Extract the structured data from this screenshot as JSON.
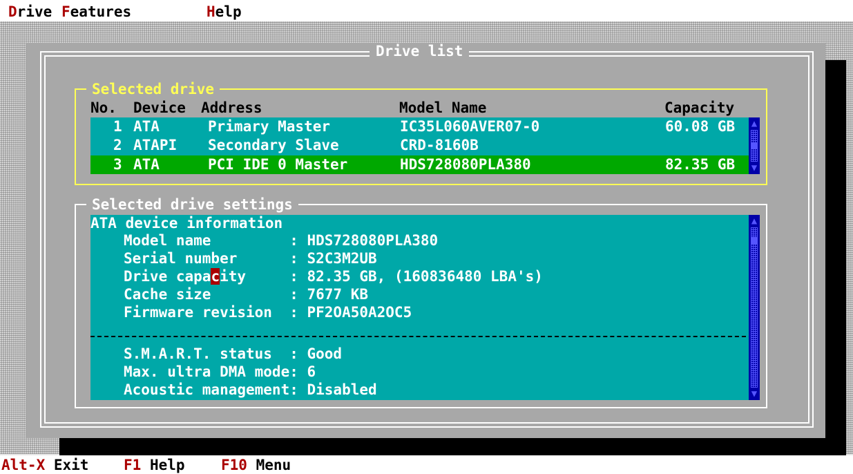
{
  "menu": {
    "items": [
      {
        "hotkey": "D",
        "rest": "rive"
      },
      {
        "hotkey": "F",
        "rest": "eatures"
      },
      {
        "hotkey": "H",
        "rest": "elp"
      }
    ]
  },
  "window": {
    "title": "Drive list"
  },
  "selected_drive": {
    "title": "Selected drive",
    "columns": {
      "no": "No.",
      "device": "Device",
      "address": "Address",
      "model": "Model Name",
      "capacity": "Capacity"
    },
    "rows": [
      {
        "no": "1",
        "device": "ATA",
        "address": "Primary Master",
        "model": "IC35L060AVER07-0",
        "capacity": "60.08 GB",
        "selected": false
      },
      {
        "no": "2",
        "device": "ATAPI",
        "address": "Secondary Slave",
        "model": "CRD-8160B",
        "capacity": "",
        "selected": false
      },
      {
        "no": "3",
        "device": "ATA",
        "address": "PCI IDE 0 Master",
        "model": "HDS728080PLA380",
        "capacity": "82.35 GB",
        "selected": true
      }
    ]
  },
  "settings": {
    "title": "Selected drive settings",
    "heading": "ATA device information",
    "lines": [
      "Model name         : HDS728080PLA380",
      "Serial number      : S2C3M2UB",
      "Drive capacity     : 82.35 GB, (160836480 LBA's)",
      "Cache size         : 7677 KB",
      "Firmware revision  : PF2OA50A2OC5",
      "S.M.A.R.T. status  : Good",
      "Max. ultra DMA mode: 6",
      "Acoustic management: Disabled"
    ]
  },
  "icons": {
    "scroll_up": "scroll-up-arrow-icon",
    "scroll_down": "scroll-down-arrow-icon"
  },
  "status": {
    "items": [
      {
        "key": "Alt-X",
        "label": "Exit"
      },
      {
        "key": "F1",
        "label": "Help"
      },
      {
        "key": "F10",
        "label": "Menu"
      }
    ]
  },
  "colors": {
    "panel": "#00a8a8",
    "selection": "#00a800",
    "hotkey": "#aa0000",
    "scrollbar": "#0000a8",
    "active_frame": "#ffff55"
  }
}
